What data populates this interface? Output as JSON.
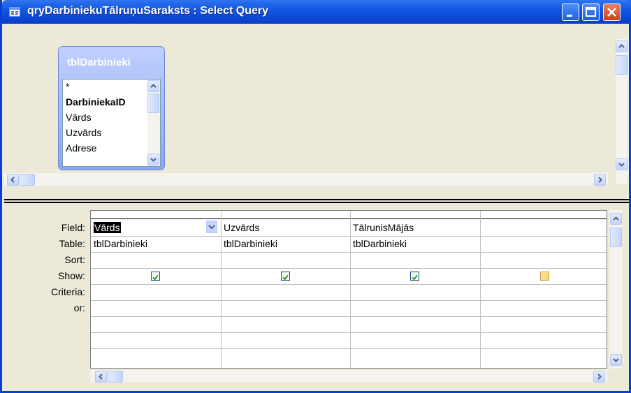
{
  "window": {
    "title": "qryDarbiniekuTālruņuSaraksts : Select Query",
    "colors": {
      "titlebar": "#0a3ed6",
      "close": "#c8401c",
      "panel": "#ece9d8"
    }
  },
  "table": {
    "name": "tblDarbinieki",
    "fields": [
      {
        "label": "*",
        "bold": false
      },
      {
        "label": "DarbiniekaID",
        "bold": true
      },
      {
        "label": "Vārds",
        "bold": false
      },
      {
        "label": "Uzvārds",
        "bold": false
      },
      {
        "label": "Adrese",
        "bold": false
      }
    ]
  },
  "grid": {
    "row_labels": [
      "Field:",
      "Table:",
      "Sort:",
      "Show:",
      "Criteria:",
      "or:"
    ],
    "columns": [
      {
        "field": "Vārds",
        "table": "tblDarbinieki",
        "sort": "",
        "show": true,
        "selected": true
      },
      {
        "field": "Uzvārds",
        "table": "tblDarbinieki",
        "sort": "",
        "show": true
      },
      {
        "field": "TālrunisMājās",
        "table": "tblDarbinieki",
        "sort": "",
        "show": true
      },
      {
        "field": "",
        "table": "",
        "sort": "",
        "show": false
      }
    ]
  }
}
